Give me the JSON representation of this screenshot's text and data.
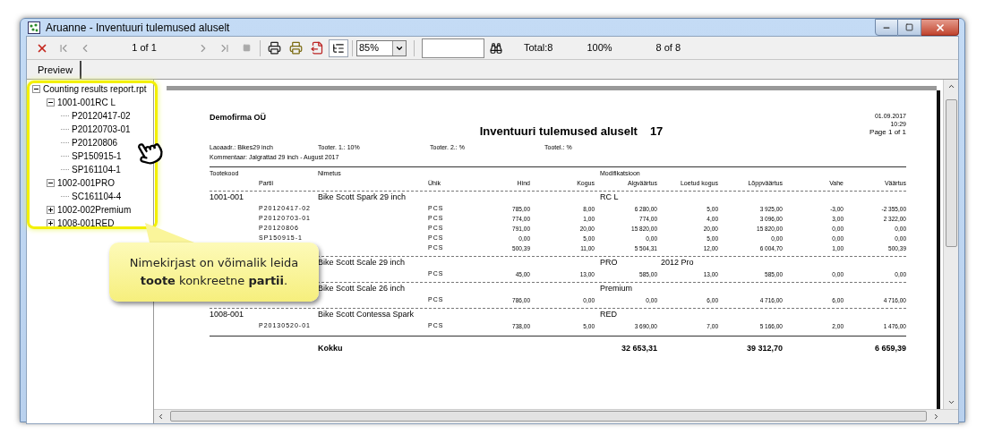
{
  "window": {
    "title": "Aruanne - Inventuuri tulemused aluselt"
  },
  "toolbar": {
    "page_indicator": "1 of 1",
    "tree_toggle_on": true,
    "zoom": "85%",
    "total": "Total:8",
    "percent": "100%",
    "match_count": "8 of 8"
  },
  "tabs": [
    {
      "label": "Preview",
      "selected": true
    }
  ],
  "tree": {
    "label": "Counting results report.rpt",
    "expanded": true,
    "children": [
      {
        "label": "1001-001RC L",
        "expanded": true,
        "children": [
          {
            "label": "P20120417-02"
          },
          {
            "label": "P20120703-01"
          },
          {
            "label": "P20120806"
          },
          {
            "label": "SP150915-1"
          },
          {
            "label": "SP161104-1"
          }
        ]
      },
      {
        "label": "1002-001PRO",
        "expanded": true,
        "children": [
          {
            "label": "SC161104-4"
          }
        ]
      },
      {
        "label": "1002-002Premium",
        "expanded": false
      },
      {
        "label": "1008-001RED",
        "expanded": false
      }
    ]
  },
  "callout": {
    "text": "Nimekirjast on võimalik leida **toote** konkreetne **partii**."
  },
  "report": {
    "company": "Demofirma OÜ",
    "date": "01.09.2017",
    "time": "10:29",
    "page": "Page 1 of 1",
    "title": "Inventuuri tulemused aluselt",
    "number": "17",
    "meta": [
      "Laoaadr.: Bikes29 inch",
      "Tooter. 1.: 10%",
      "Tooter. 2.: %",
      "Tootel.: %"
    ],
    "comment": "Kommentaar: Jalgrattad 29 inch - August 2017",
    "header": {
      "code": "Tootekood",
      "name": "Nimetus",
      "modification": "Modifikatsioon"
    },
    "columns": [
      "Partii",
      "Ühik",
      "Hind",
      "Kogus",
      "Algväärtus",
      "Loetud kogus",
      "Lõppväärtus",
      "Vahe",
      "Väärtus"
    ],
    "groups": [
      {
        "code": "1001-001",
        "name": "Bike Scott Spark 29 inch",
        "modification": "RC L",
        "rows": [
          {
            "partii": "P20120417-02",
            "unit": "PCS",
            "values": [
              "785,00",
              "8,00",
              "6 280,00",
              "5,00",
              "3 925,00",
              "-3,00",
              "-2 355,00"
            ]
          },
          {
            "partii": "P20120703-01",
            "unit": "PCS",
            "values": [
              "774,00",
              "1,00",
              "774,00",
              "4,00",
              "3 096,00",
              "3,00",
              "2 322,00"
            ]
          },
          {
            "partii": "P20120806",
            "unit": "PCS",
            "values": [
              "791,00",
              "20,00",
              "15 820,00",
              "20,00",
              "15 820,00",
              "0,00",
              "0,00"
            ]
          },
          {
            "partii": "SP150915-1",
            "unit": "PCS",
            "values": [
              "0,00",
              "5,00",
              "0,00",
              "5,00",
              "0,00",
              "0,00",
              "0,00"
            ]
          },
          {
            "unit": "PCS",
            "values": [
              "500,39",
              "11,00",
              "5 504,31",
              "12,00",
              "6 004,70",
              "1,00",
              "500,39"
            ]
          }
        ]
      },
      {
        "name": "Bike Scott Scale 29 inch",
        "modification": "PRO",
        "modification_2": "2012 Pro",
        "rows": [
          {
            "unit": "PCS",
            "values": [
              "45,00",
              "13,00",
              "585,00",
              "13,00",
              "585,00",
              "0,00",
              "0,00"
            ]
          }
        ]
      },
      {
        "name": "Bike Scott Scale 26 inch",
        "modification": "Premium",
        "rows": [
          {
            "unit": "PCS",
            "values": [
              "786,00",
              "0,00",
              "0,00",
              "6,00",
              "4 716,00",
              "6,00",
              "4 716,00"
            ]
          }
        ]
      },
      {
        "code": "1008-001",
        "name": "Bike Scott Contessa Spark",
        "modification": "RED",
        "rows": [
          {
            "partii": "P20130520-01",
            "unit": "PCS",
            "values": [
              "738,00",
              "5,00",
              "3 690,00",
              "7,00",
              "5 166,00",
              "2,00",
              "1 476,00"
            ]
          }
        ]
      }
    ],
    "total": {
      "label": "Kokku",
      "values": [
        "32 653,31",
        "39 312,70",
        "6 659,39"
      ]
    }
  }
}
